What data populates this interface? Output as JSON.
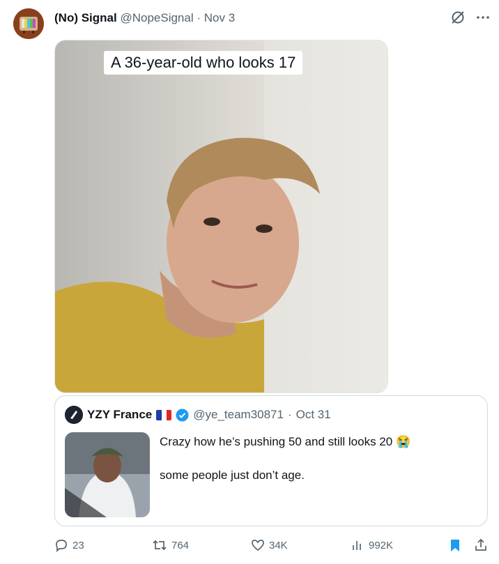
{
  "tweet": {
    "author_name": "(No) Signal",
    "author_handle": "@NopeSignal",
    "separator": "·",
    "date": "Nov 3",
    "image_caption": "A 36-year-old who looks 17"
  },
  "quoted_tweet": {
    "author_name": "YZY France",
    "author_handle": "@ye_team30871",
    "separator": "·",
    "date": "Oct 31",
    "line1": "Crazy how he’s pushing 50 and still looks 20",
    "emoji": "😭",
    "line2": "some people just don’t age."
  },
  "actions": {
    "replies": "23",
    "reposts": "764",
    "likes": "34K",
    "views": "992K"
  },
  "colors": {
    "muted": "#536471",
    "accent_blue": "#1d9bf0"
  }
}
